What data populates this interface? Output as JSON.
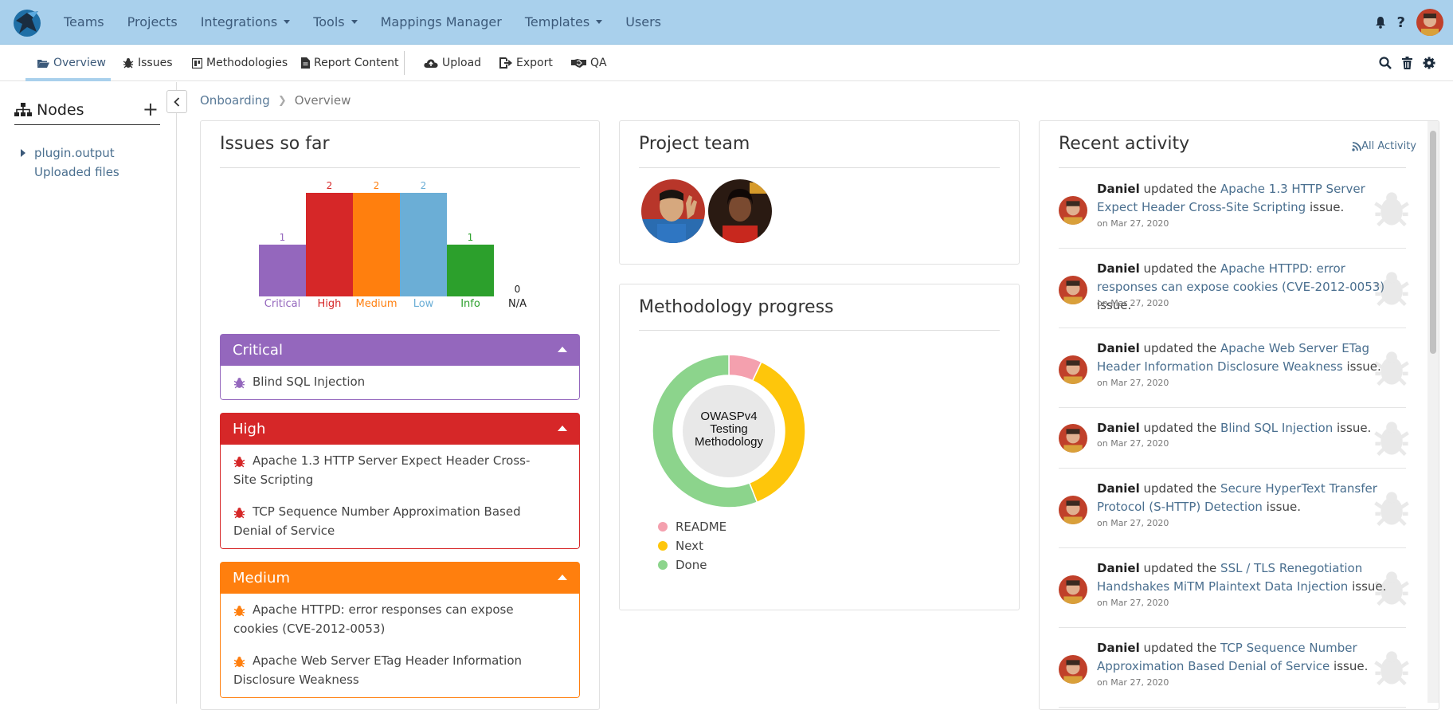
{
  "topnav": {
    "items": [
      {
        "label": "Teams",
        "dropdown": false
      },
      {
        "label": "Projects",
        "dropdown": false
      },
      {
        "label": "Integrations",
        "dropdown": true
      },
      {
        "label": "Tools",
        "dropdown": true
      },
      {
        "label": "Mappings Manager",
        "dropdown": false
      },
      {
        "label": "Templates",
        "dropdown": true
      },
      {
        "label": "Users",
        "dropdown": false
      }
    ],
    "help": "?"
  },
  "subnav": {
    "tabs": [
      "Overview",
      "Issues",
      "Methodologies",
      "Report Content",
      "Upload",
      "Export",
      "QA"
    ],
    "active": "Overview"
  },
  "sidebar": {
    "title": "Nodes",
    "add": "+",
    "nodes": [
      {
        "label": "plugin.output",
        "expandable": true
      }
    ],
    "uploaded": "Uploaded files"
  },
  "breadcrumb": {
    "parent": "Onboarding",
    "current": "Overview"
  },
  "issues_card": {
    "title": "Issues so far",
    "sections": [
      {
        "name": "Critical",
        "color": "#9467bd",
        "issues": [
          "Blind SQL Injection"
        ]
      },
      {
        "name": "High",
        "color": "#d62728",
        "issues": [
          "Apache 1.3 HTTP Server Expect Header Cross-Site Scripting",
          "TCP Sequence Number Approximation Based Denial of Service"
        ]
      },
      {
        "name": "Medium",
        "color": "#ff7f0e",
        "issues": [
          "Apache HTTPD: error responses can expose cookies (CVE-2012-0053)",
          "Apache Web Server ETag Header Information Disclosure Weakness"
        ]
      }
    ]
  },
  "chart_data": {
    "type": "bar",
    "categories": [
      "Critical",
      "High",
      "Medium",
      "Low",
      "Info",
      "N/A"
    ],
    "values": [
      1,
      2,
      2,
      2,
      1,
      0
    ],
    "colors": [
      "#9467bd",
      "#d62728",
      "#ff7f0e",
      "#6baed6",
      "#2ca02c",
      "#222222"
    ],
    "ylim": [
      0,
      2
    ]
  },
  "team_card": {
    "title": "Project team"
  },
  "methodology_card": {
    "title": "Methodology progress",
    "center_label": [
      "OWASPv4",
      "Testing",
      "Methodology"
    ],
    "segments": [
      {
        "name": "README",
        "value": 0.07,
        "color": "#f4a0ae"
      },
      {
        "name": "Next",
        "value": 0.37,
        "color": "#fec60b"
      },
      {
        "name": "Done",
        "value": 0.56,
        "color": "#8cd48c"
      }
    ]
  },
  "activity_card": {
    "title": "Recent activity",
    "all_link": "All Activity",
    "items": [
      {
        "user": "Daniel",
        "verb": "updated the",
        "link": "Apache 1.3 HTTP Server Expect Header Cross-Site Scripting",
        "suffix": "issue.",
        "date": "on Mar 27, 2020"
      },
      {
        "user": "Daniel",
        "verb": "updated the",
        "link": "Apache HTTPD: error responses can expose cookies (CVE-2012-0053)",
        "suffix": "issue.",
        "date": "on Mar 27, 2020"
      },
      {
        "user": "Daniel",
        "verb": "updated the",
        "link": "Apache Web Server ETag Header Information Disclosure Weakness",
        "suffix": "issue.",
        "date": "on Mar 27, 2020"
      },
      {
        "user": "Daniel",
        "verb": "updated the",
        "link": "Blind SQL Injection",
        "suffix": "issue.",
        "date": "on Mar 27, 2020"
      },
      {
        "user": "Daniel",
        "verb": "updated the",
        "link": "Secure HyperText Transfer Protocol (S-HTTP) Detection",
        "suffix": "issue.",
        "date": "on Mar 27, 2020"
      },
      {
        "user": "Daniel",
        "verb": "updated the",
        "link": "SSL / TLS Renegotiation Handshakes MiTM Plaintext Data Injection",
        "suffix": "issue.",
        "date": "on Mar 27, 2020"
      },
      {
        "user": "Daniel",
        "verb": "updated the",
        "link": "TCP Sequence Number Approximation Based Denial of Service",
        "suffix": "issue.",
        "date": "on Mar 27, 2020"
      }
    ]
  }
}
